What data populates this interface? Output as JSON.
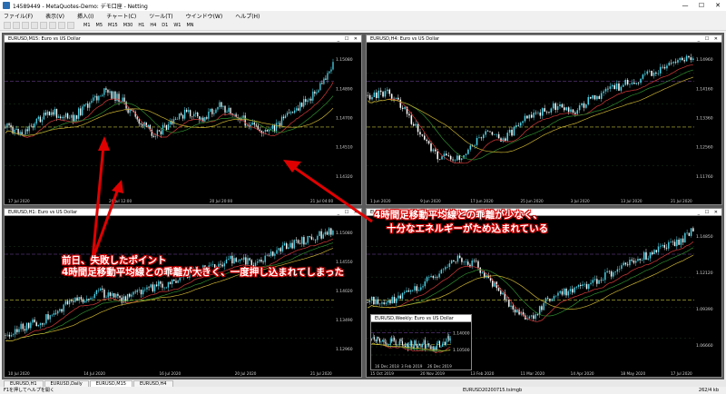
{
  "app": {
    "title": "14589449 - MetaQuotes-Demo: デモ口座 - Netting",
    "window_controls": [
      "—",
      "☐",
      "✕"
    ]
  },
  "menu": [
    "ファイル(F)",
    "表示(V)",
    "挿入(I)",
    "チャート(C)",
    "ツール(T)",
    "ウインドウ(W)",
    "ヘルプ(H)"
  ],
  "timeframes": [
    "M1",
    "M5",
    "M15",
    "M30",
    "H1",
    "H4",
    "D1",
    "W1",
    "MN"
  ],
  "charts": [
    {
      "id": "m15",
      "caption": "EURUSD,M15: Euro vs US Dollar",
      "axis": [
        "1.15080",
        "1.14890",
        "1.14700",
        "1.14510",
        "1.14320"
      ],
      "dates": [
        "17 Jul 2020",
        "20 Jul 12:00",
        "20 Jul 20:00",
        "21 Jul 04:00"
      ]
    },
    {
      "id": "h4",
      "caption": "EURUSD,H4: Euro vs US Dollar",
      "axis": [
        "1.14960",
        "1.14160",
        "1.13360",
        "1.12560",
        "1.11760"
      ],
      "dates": [
        "1 Jun 2020",
        "9 Jun 2020",
        "17 Jun 2020",
        "25 Jun 2020",
        "3 Jul 2020",
        "13 Jul 2020",
        "21 Jul 2020"
      ]
    },
    {
      "id": "h1",
      "caption": "EURUSD,H1: Euro vs US Dollar",
      "axis": [
        "1.15080",
        "1.14550",
        "1.14020",
        "1.13490",
        "1.12960"
      ],
      "dates": [
        "10 Jul 2020",
        "14 Jul 2020",
        "16 Jul 2020",
        "20 Jul 2020",
        "21 Jul 2020"
      ]
    },
    {
      "id": "d1",
      "caption": "EURUSD,D1: Euro vs US Dollar",
      "axis": [
        "1.14850",
        "1.12120",
        "1.09390",
        "1.06660"
      ],
      "dates": [
        "15 Oct 2019",
        "20 Nov 2019",
        "13 Feb 2020",
        "11 Mar 2020",
        "14 Apr 2020",
        "18 May 2020",
        "17 Jul 2020"
      ]
    },
    {
      "id": "w1",
      "caption": "EURUSD,Weekly: Euro vs US Dollar",
      "axis": [
        "1.14000",
        "1.10500"
      ],
      "dates": [
        "16 Dec 2018",
        "3 Feb 2019",
        "26 Dec 2019"
      ]
    }
  ],
  "tabs": [
    "EURUSD,H1",
    "EURUSD,Daily",
    "EURUSD,M15",
    "EURUSD,H4"
  ],
  "status": {
    "help": "F1を押してヘルプを開く",
    "file": "EURUSD20200715.tsimgb",
    "kb": "262/4 kb"
  },
  "annotations": {
    "top_line1": "4時間足移動平均線との乖離が少なく、",
    "top_line2": "十分なエネルギーがため込まれている",
    "bottom_line1": "前日、失敗したポイント",
    "bottom_line2": "4時間足移動平均線との乖離が大きく、一度押し込まれてしまった"
  }
}
